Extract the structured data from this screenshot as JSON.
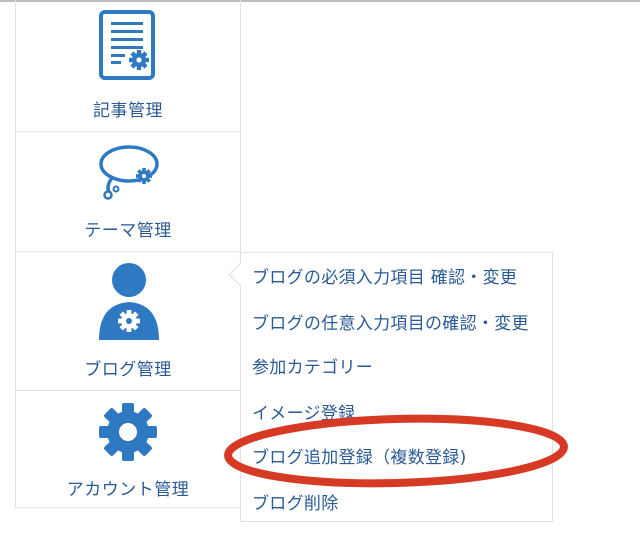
{
  "sidebar": {
    "items": [
      {
        "label": "記事管理",
        "icon": "document-gear-icon"
      },
      {
        "label": "テーマ管理",
        "icon": "thought-bubble-gear-icon"
      },
      {
        "label": "ブログ管理",
        "icon": "user-gear-icon"
      },
      {
        "label": "アカウント管理",
        "icon": "gear-icon"
      }
    ]
  },
  "submenu": {
    "items": [
      {
        "label": "ブログの必須入力項目 確認・変更"
      },
      {
        "label": "ブログの任意入力項目の確認・変更"
      },
      {
        "label": "参加カテゴリー"
      },
      {
        "label": "イメージ登録"
      },
      {
        "label": "ブログ追加登録（複数登録)"
      },
      {
        "label": "ブログ削除"
      }
    ]
  },
  "colors": {
    "accent": "#2f79c2",
    "text": "#2a5a95",
    "highlight": "#d63a24"
  }
}
